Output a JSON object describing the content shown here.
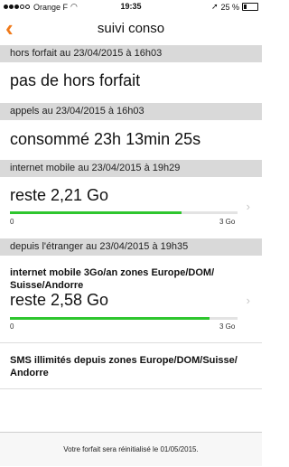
{
  "status_bar": {
    "carrier": "Orange F",
    "time": "19:35",
    "battery": "25 %"
  },
  "nav": {
    "title": "suivi conso"
  },
  "sections": {
    "hors_forfait": {
      "header": "hors forfait au 23/04/2015 à 16h03",
      "value": "pas de hors forfait"
    },
    "appels": {
      "header": "appels au 23/04/2015 à 16h03",
      "value": "consommé 23h 13min 25s"
    },
    "internet_mobile": {
      "header": "internet mobile au 23/04/2015 à 19h29",
      "value": "reste 2,21 Go",
      "scale_min": "0",
      "scale_max": "3 Go",
      "fill_fraction": 0.755
    },
    "etranger": {
      "header": "depuis l'étranger au 23/04/2015 à 19h35",
      "internet_label": "internet mobile 3Go/an zones Europe/DOM/ Suisse/Andorre",
      "internet_value": "reste 2,58 Go",
      "scale_min": "0",
      "scale_max": "3 Go",
      "fill_fraction": 0.875,
      "sms_label": "SMS illimités depuis zones Europe/DOM/Suisse/ Andorre"
    }
  },
  "footer": {
    "text": "Votre forfait sera réinitialisé le 01/05/2015."
  },
  "colors": {
    "accent": "#f07a1a",
    "progress": "#2ec62e",
    "section_bg": "#d9d9d9"
  }
}
